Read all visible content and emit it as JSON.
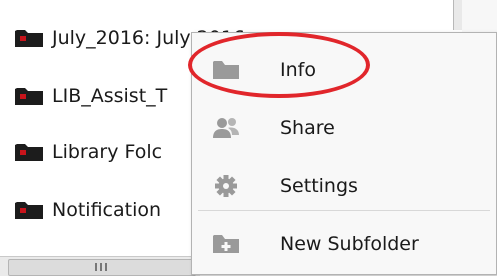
{
  "folders": [
    {
      "name": "July_2016: July 2016"
    },
    {
      "name": "LIB_Assist_T"
    },
    {
      "name": "Library Folc"
    },
    {
      "name": "Notification"
    },
    {
      "name": ""
    }
  ],
  "context_menu": {
    "items": [
      {
        "label": "Info",
        "icon": "folder-icon",
        "highlighted": true
      },
      {
        "label": "Share",
        "icon": "people-icon"
      },
      {
        "label": "Settings",
        "icon": "gear-icon"
      },
      {
        "label": "New Subfolder",
        "icon": "new-subfolder-icon"
      }
    ]
  },
  "colors": {
    "highlight_annotation": "#e1262b",
    "folder_icon": "#1c1c1c",
    "folder_badge": "#c8141b",
    "menu_icon": "#9a9a9a",
    "menu_bg": "#f8f8f8"
  }
}
